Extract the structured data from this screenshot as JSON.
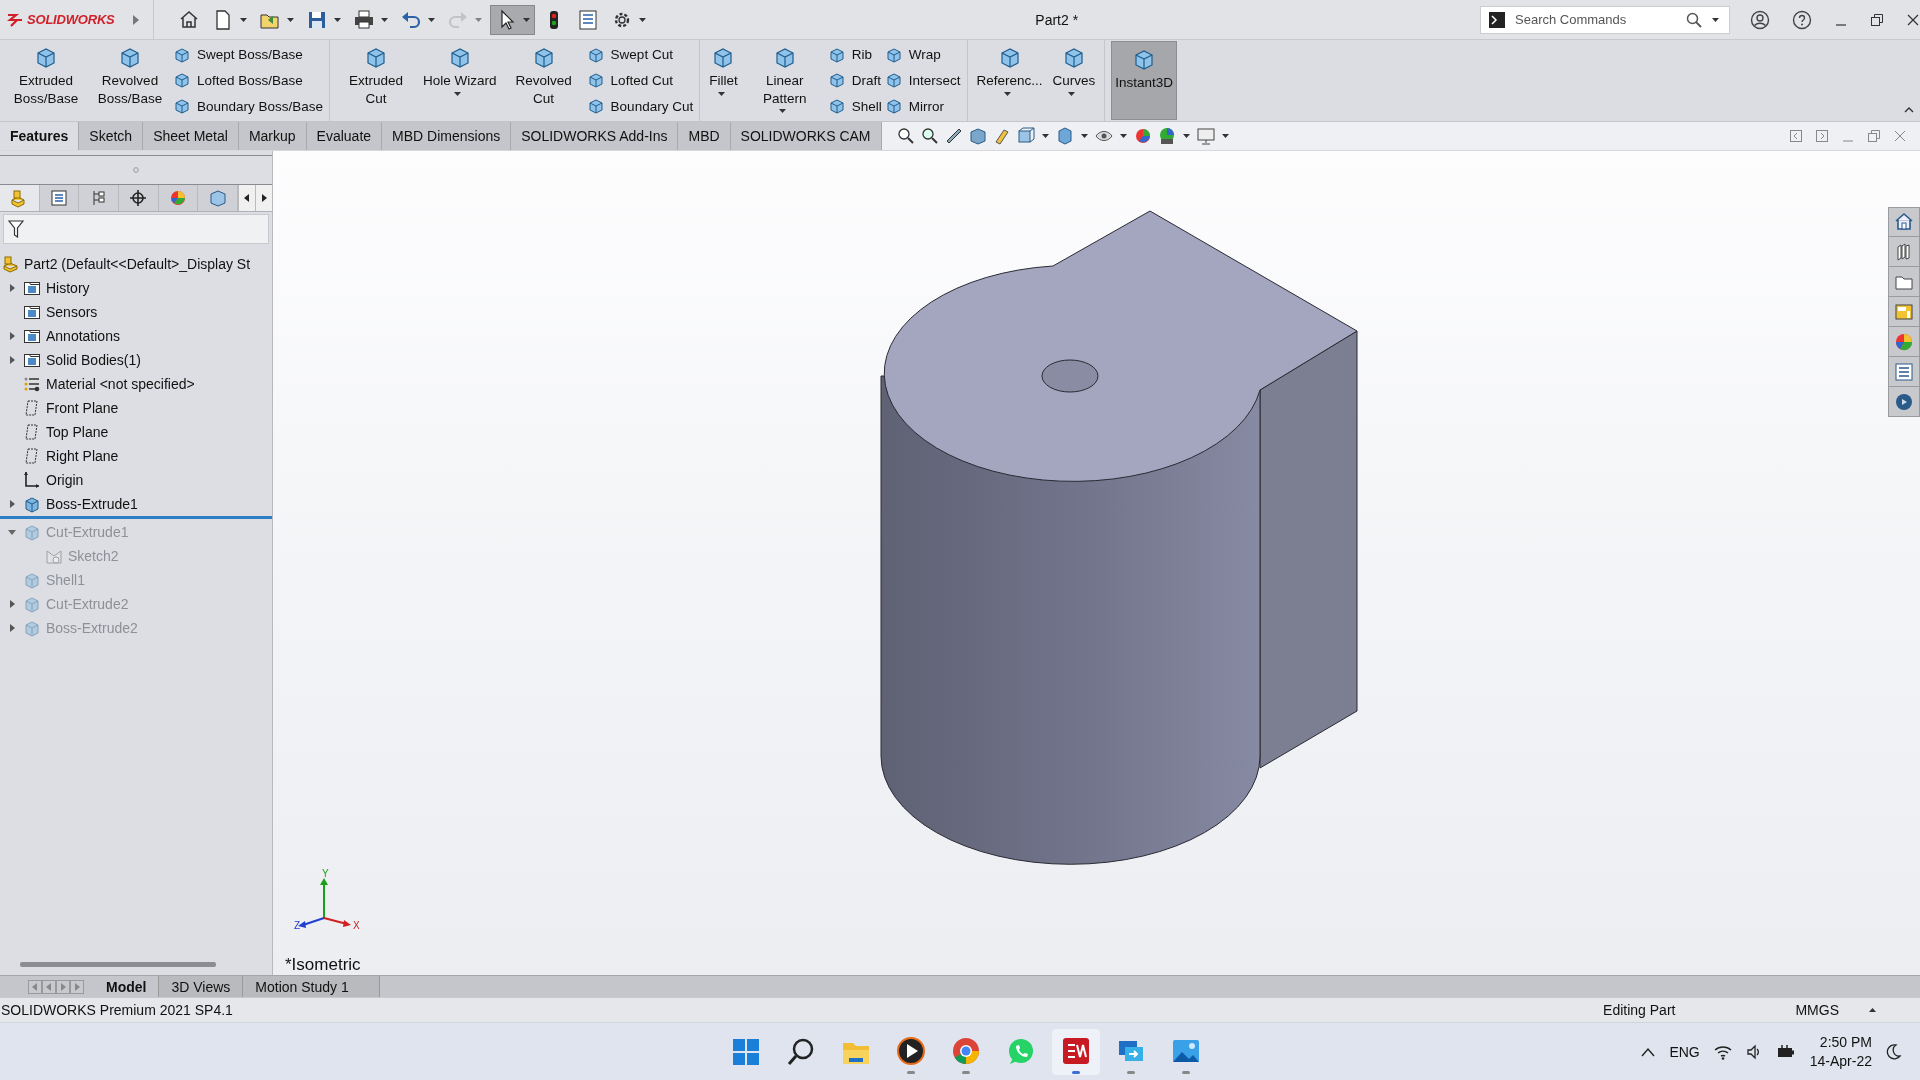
{
  "app": {
    "logo": "SOLIDWORKS",
    "document_title": "Part2 *"
  },
  "quick_access": [
    {
      "kind": "home",
      "dropdown": false,
      "selected": false,
      "disabled": false
    },
    {
      "kind": "new",
      "dropdown": true,
      "selected": false,
      "disabled": false
    },
    {
      "kind": "open",
      "dropdown": true,
      "selected": false,
      "disabled": false
    },
    {
      "kind": "save",
      "dropdown": true,
      "selected": false,
      "disabled": false
    },
    {
      "kind": "print",
      "dropdown": true,
      "selected": false,
      "disabled": false
    },
    {
      "kind": "undo",
      "dropdown": true,
      "selected": false,
      "disabled": false
    },
    {
      "kind": "redo",
      "dropdown": true,
      "selected": false,
      "disabled": true
    },
    {
      "kind": "select",
      "dropdown": true,
      "selected": true,
      "disabled": false
    },
    {
      "kind": "rebuild",
      "dropdown": false,
      "selected": false,
      "disabled": false
    },
    {
      "kind": "properties",
      "dropdown": false,
      "selected": false,
      "disabled": false
    },
    {
      "kind": "options",
      "dropdown": true,
      "selected": false,
      "disabled": false
    }
  ],
  "search": {
    "placeholder": "Search Commands"
  },
  "ribbon": [
    [
      {
        "kind": "large",
        "label": "Extruded Boss/Base",
        "dropdown": false,
        "selected": false
      },
      {
        "kind": "large",
        "label": "Revolved Boss/Base",
        "dropdown": false,
        "selected": false
      },
      {
        "kind": "stack",
        "items": [
          {
            "label": "Swept Boss/Base"
          },
          {
            "label": "Lofted Boss/Base"
          },
          {
            "label": "Boundary Boss/Base"
          }
        ]
      }
    ],
    [
      {
        "kind": "large",
        "label": "Extruded Cut",
        "dropdown": false,
        "selected": false
      },
      {
        "kind": "large",
        "label": "Hole Wizard",
        "dropdown": true,
        "selected": false
      },
      {
        "kind": "large",
        "label": "Revolved Cut",
        "dropdown": false,
        "selected": false
      },
      {
        "kind": "stack",
        "items": [
          {
            "label": "Swept Cut"
          },
          {
            "label": "Lofted Cut"
          },
          {
            "label": "Boundary Cut"
          }
        ]
      }
    ],
    [
      {
        "kind": "large",
        "label": "Fillet",
        "dropdown": true,
        "selected": false
      },
      {
        "kind": "large",
        "label": "Linear Pattern",
        "dropdown": true,
        "selected": false
      },
      {
        "kind": "stack",
        "items": [
          {
            "label": "Rib"
          },
          {
            "label": "Draft"
          },
          {
            "label": "Shell"
          }
        ]
      },
      {
        "kind": "stack",
        "items": [
          {
            "label": "Wrap"
          },
          {
            "label": "Intersect"
          },
          {
            "label": "Mirror"
          }
        ]
      }
    ],
    [
      {
        "kind": "large",
        "label": "Referenc...",
        "dropdown": true,
        "selected": false
      },
      {
        "kind": "large",
        "label": "Curves",
        "dropdown": true,
        "selected": false
      }
    ],
    [
      {
        "kind": "large",
        "label": "Instant3D",
        "dropdown": false,
        "selected": true
      }
    ]
  ],
  "tabs": [
    {
      "label": "Features",
      "selected": true
    },
    {
      "label": "Sketch",
      "selected": false
    },
    {
      "label": "Sheet Metal",
      "selected": false
    },
    {
      "label": "Markup",
      "selected": false
    },
    {
      "label": "Evaluate",
      "selected": false
    },
    {
      "label": "MBD Dimensions",
      "selected": false
    },
    {
      "label": "SOLIDWORKS Add-Ins",
      "selected": false
    },
    {
      "label": "MBD",
      "selected": false
    },
    {
      "label": "SOLIDWORKS CAM",
      "selected": false
    }
  ],
  "feature_tree": {
    "label": "Part2  (Default<<Default>_Display St",
    "kind": "part",
    "suppressed": false,
    "children": [
      {
        "label": "History",
        "kind": "folder",
        "expanded": false,
        "suppressed": false
      },
      {
        "label": "Sensors",
        "kind": "folder",
        "suppressed": false
      },
      {
        "label": "Annotations",
        "kind": "folder",
        "expanded": false,
        "suppressed": false
      },
      {
        "label": "Solid Bodies(1)",
        "kind": "folder",
        "expanded": false,
        "suppressed": false
      },
      {
        "label": "Material <not specified>",
        "kind": "material",
        "suppressed": false
      },
      {
        "label": "Front Plane",
        "kind": "plane",
        "suppressed": false
      },
      {
        "label": "Top Plane",
        "kind": "plane",
        "suppressed": false
      },
      {
        "label": "Right Plane",
        "kind": "plane",
        "suppressed": false
      },
      {
        "label": "Origin",
        "kind": "origin",
        "suppressed": false
      },
      {
        "label": "Boss-Extrude1",
        "kind": "feature",
        "expanded": false,
        "suppressed": false
      },
      {
        "kind": "rollback"
      },
      {
        "label": "Cut-Extrude1",
        "kind": "feature",
        "expanded": true,
        "suppressed": true,
        "children": [
          {
            "label": "Sketch2",
            "kind": "sketch",
            "suppressed": true
          }
        ]
      },
      {
        "label": "Shell1",
        "kind": "feature",
        "suppressed": true
      },
      {
        "label": "Cut-Extrude2",
        "kind": "feature",
        "expanded": false,
        "suppressed": true
      },
      {
        "label": "Boss-Extrude2",
        "kind": "feature",
        "expanded": false,
        "suppressed": true
      }
    ]
  },
  "viewport": {
    "view_name": "*Isometric",
    "triad": [
      "X",
      "Y",
      "Z"
    ]
  },
  "bottom_tabs": [
    {
      "label": "Model",
      "selected": true
    },
    {
      "label": "3D Views",
      "selected": false
    },
    {
      "label": "Motion Study 1",
      "selected": false
    }
  ],
  "status_bar": {
    "product": "SOLIDWORKS Premium 2021 SP4.1",
    "mode": "Editing Part",
    "units": "MMGS"
  },
  "taskbar": {
    "language": "ENG",
    "time": "2:50 PM",
    "date": "14-Apr-22"
  }
}
